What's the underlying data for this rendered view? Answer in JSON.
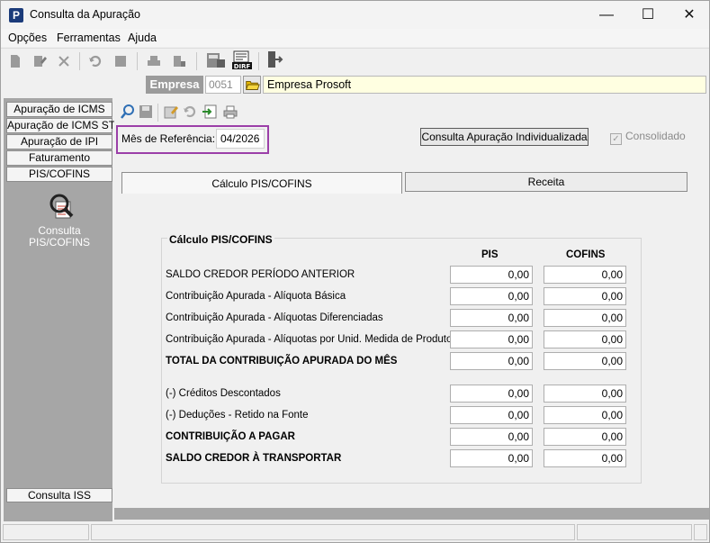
{
  "window": {
    "title": "Consulta da Apuração",
    "app_icon_letter": "P"
  },
  "menu": {
    "items": [
      "Opções",
      "Ferramentas",
      "Ajuda"
    ]
  },
  "toolbar": {
    "icons": [
      "new-icon",
      "edit-icon",
      "delete-icon",
      "undo-icon",
      "stop-icon",
      "print-icon",
      "print-setup-icon",
      "calculator-icon",
      "sped-icon",
      "exit-door-icon"
    ]
  },
  "empresa": {
    "label": "Empresa",
    "code": "0051",
    "name": "Empresa Prosoft"
  },
  "sidebar": {
    "tabs": [
      "Apuração de ICMS",
      "Apuração de ICMS ST",
      "Apuração de IPI",
      "Faturamento",
      "PIS/COFINS"
    ],
    "panel_item": {
      "label_line1": "Consulta",
      "label_line2": "PIS/COFINS"
    },
    "bottom_tab": "Consulta ISS"
  },
  "content": {
    "mes_label": "Mês de Referência:",
    "mes_value": "04/2026",
    "consulta_button": "Consulta Apuração Individualizada",
    "consolidado_label": "Consolidado",
    "tabs": [
      "Cálculo PIS/COFINS",
      "Receita"
    ]
  },
  "group": {
    "title": "Cálculo PIS/COFINS",
    "col_pis": "PIS",
    "col_cofins": "COFINS",
    "rows": [
      {
        "label": "SALDO CREDOR PERÍODO ANTERIOR",
        "pis": "0,00",
        "cofins": "0,00"
      },
      {
        "label": "Contribuição Apurada - Alíquota Básica",
        "pis": "0,00",
        "cofins": "0,00"
      },
      {
        "label": "Contribuição Apurada - Alíquotas Diferenciadas",
        "pis": "0,00",
        "cofins": "0,00"
      },
      {
        "label": "Contribuição Apurada - Alíquotas por Unid. Medida de Produto",
        "pis": "0,00",
        "cofins": "0,00"
      },
      {
        "label": "TOTAL DA CONTRIBUIÇÃO APURADA DO MÊS",
        "pis": "0,00",
        "cofins": "0,00"
      },
      {
        "label": "(-) Créditos Descontados",
        "pis": "0,00",
        "cofins": "0,00"
      },
      {
        "label": "(-) Deduções - Retido na Fonte",
        "pis": "0,00",
        "cofins": "0,00"
      },
      {
        "label": "CONTRIBUIÇÃO A PAGAR",
        "pis": "0,00",
        "cofins": "0,00"
      },
      {
        "label": "SALDO CREDOR À TRANSPORTAR",
        "pis": "0,00",
        "cofins": "0,00"
      }
    ]
  },
  "colors": {
    "accent_highlight": "#9b3fa8",
    "sidebar_bg": "#a6a6a6",
    "empresa_bg": "#ffffe1"
  }
}
